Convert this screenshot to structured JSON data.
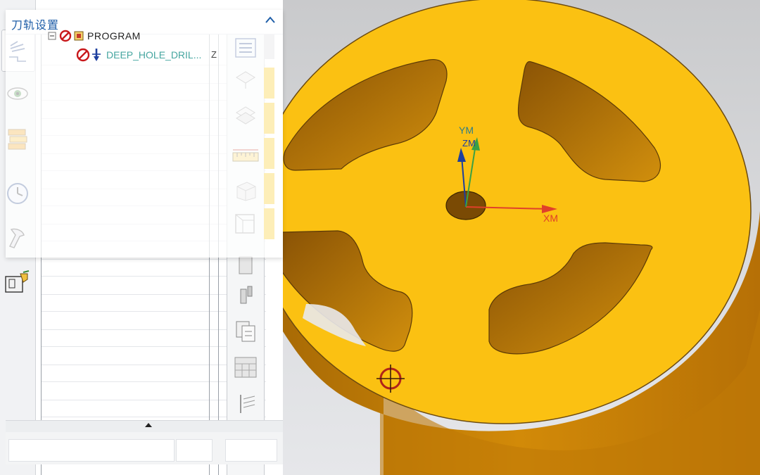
{
  "dialog": {
    "title": "刀轨设置",
    "collapse_icon": "chevron-up-icon"
  },
  "tree": {
    "nodes": [
      {
        "label": "PROGRAM",
        "status": "error-icon",
        "type": "program-group-icon"
      },
      {
        "label": "DEEP_HOLE_DRIL...",
        "status": "error-icon",
        "type": "drill-tool-icon"
      }
    ],
    "second_column_value": "Z"
  },
  "resource_bar": {
    "items": [
      "toolpath-settings-icon",
      "view-eye-icon",
      "material-stack-icon",
      "history-clock-icon",
      "machine-tool-icon",
      "process-doc-icon"
    ]
  },
  "toolbar": {
    "items": [
      "operation-list-icon",
      "plane-layer-icon",
      "cut-level-icon",
      "ruler-measure-icon",
      "box-part-icon",
      "box-wire-icon",
      "cylinder-icon",
      "tool-shaft-icon",
      "copy-report-icon",
      "table-grid-icon",
      "drill-path-icon",
      "arc-tool-icon"
    ]
  },
  "viewport": {
    "axes": {
      "x_label": "XM",
      "y_label": "YM",
      "z_label": "ZM"
    },
    "colors": {
      "part": "#fbc112",
      "part_side": "#c98306",
      "x_axis": "#e0402a",
      "y_axis": "#1d3f9e",
      "z_axis": "#3aa044"
    },
    "cursor": "crosshair-cursor-icon"
  }
}
